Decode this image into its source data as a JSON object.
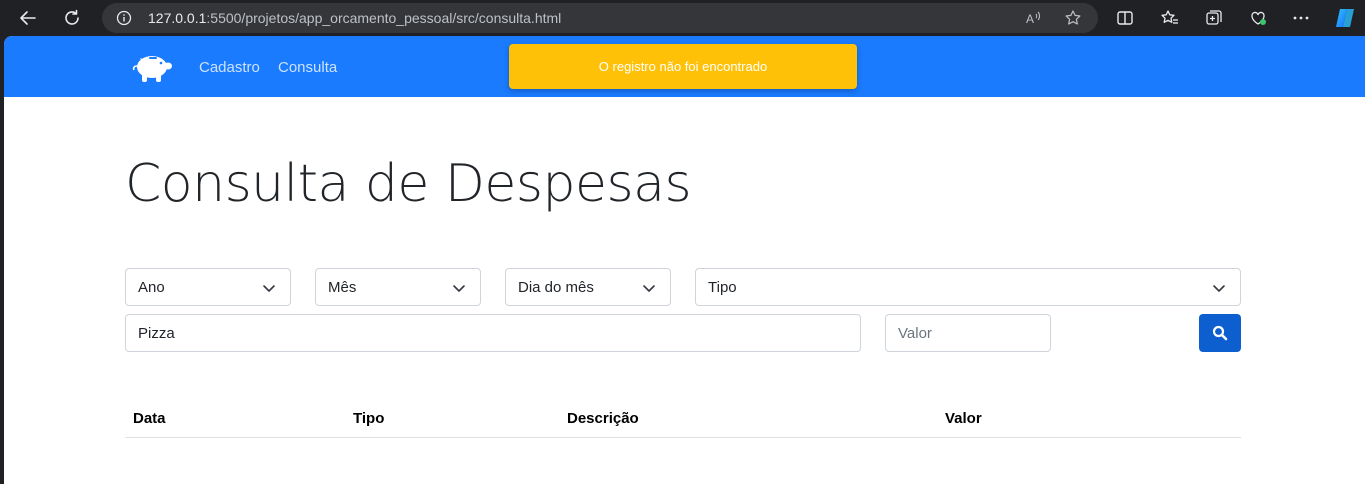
{
  "browser": {
    "url_host": "127.0.0.1",
    "url_rest": ":5500/projetos/app_orcamento_pessoal/src/consulta.html"
  },
  "navbar": {
    "links": [
      {
        "label": "Cadastro"
      },
      {
        "label": "Consulta"
      }
    ],
    "brand_color": "#1a7bff"
  },
  "toast": {
    "message": "O registro não foi encontrado",
    "color": "#ffc107"
  },
  "main": {
    "title": "Consulta de Despesas",
    "filters": {
      "ano": "Ano",
      "mes": "Mês",
      "dia": "Dia do mês",
      "tipo": "Tipo",
      "descricao_value": "Pizza",
      "valor_placeholder": "Valor"
    },
    "table": {
      "headers": [
        "Data",
        "Tipo",
        "Descrição",
        "Valor"
      ]
    }
  }
}
